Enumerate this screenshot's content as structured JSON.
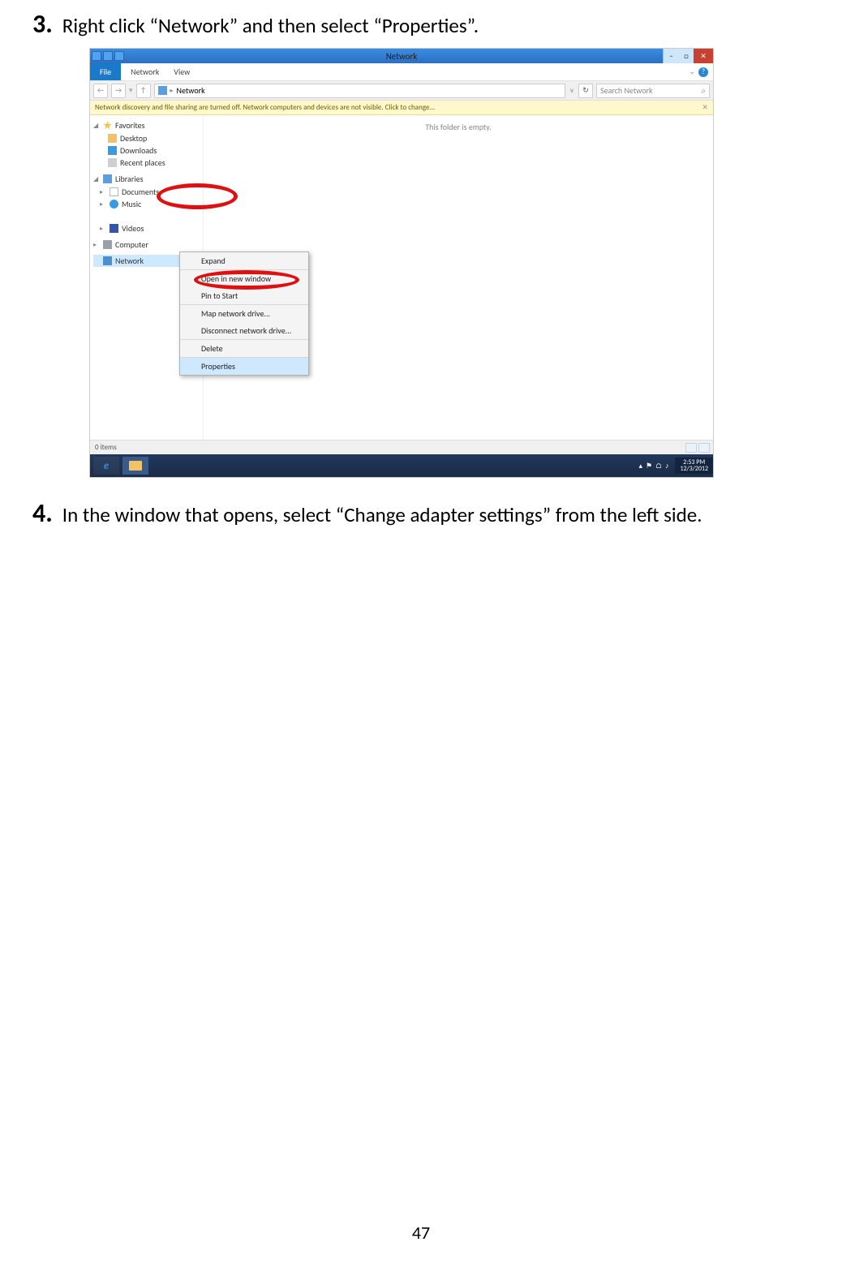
{
  "steps": {
    "s3": {
      "num": "3.",
      "text": "Right click “Network” and then select “Properties”."
    },
    "s4": {
      "num": "4.",
      "text": "In the window that opens, select “Change adapter settings” from the left side."
    }
  },
  "page_number": "47",
  "win": {
    "title": "Network",
    "min": "−",
    "max": "□",
    "close": "✕",
    "ribbon": {
      "file": "File",
      "tab_network": "Network",
      "tab_view": "View",
      "expand": "⌄",
      "help": "?"
    },
    "addr": {
      "back": "←",
      "fwd": "→",
      "up": "↑",
      "sep": "▸",
      "crumb": "Network",
      "refresh": "↻"
    },
    "search": {
      "placeholder": "Search Network",
      "icon": "⌕"
    },
    "infobar": {
      "text": "Network discovery and file sharing are turned off. Network computers and devices are not visible. Click to change...",
      "close": "✕"
    },
    "nav": {
      "fav_head": "Favorites",
      "fav_desktop": "Desktop",
      "fav_downloads": "Downloads",
      "fav_recent": "Recent places",
      "lib_head": "Libraries",
      "lib_documents": "Documents",
      "lib_music": "Music",
      "lib_videos": "Videos",
      "computer": "Computer",
      "network": "Network"
    },
    "empty_text": "This folder is empty.",
    "ctx": {
      "expand": "Expand",
      "open_new": "Open in new window",
      "pin": "Pin to Start",
      "map": "Map network drive...",
      "disc": "Disconnect network drive...",
      "del": "Delete",
      "props": "Properties"
    },
    "status": {
      "items": "0 items"
    },
    "taskbar": {
      "ie": "e",
      "tray_up": "▴",
      "tray_flag": "⚑",
      "tray_net": "⌂",
      "tray_snd": "♪",
      "clock_time": "2:53 PM",
      "clock_date": "12/3/2012"
    }
  }
}
